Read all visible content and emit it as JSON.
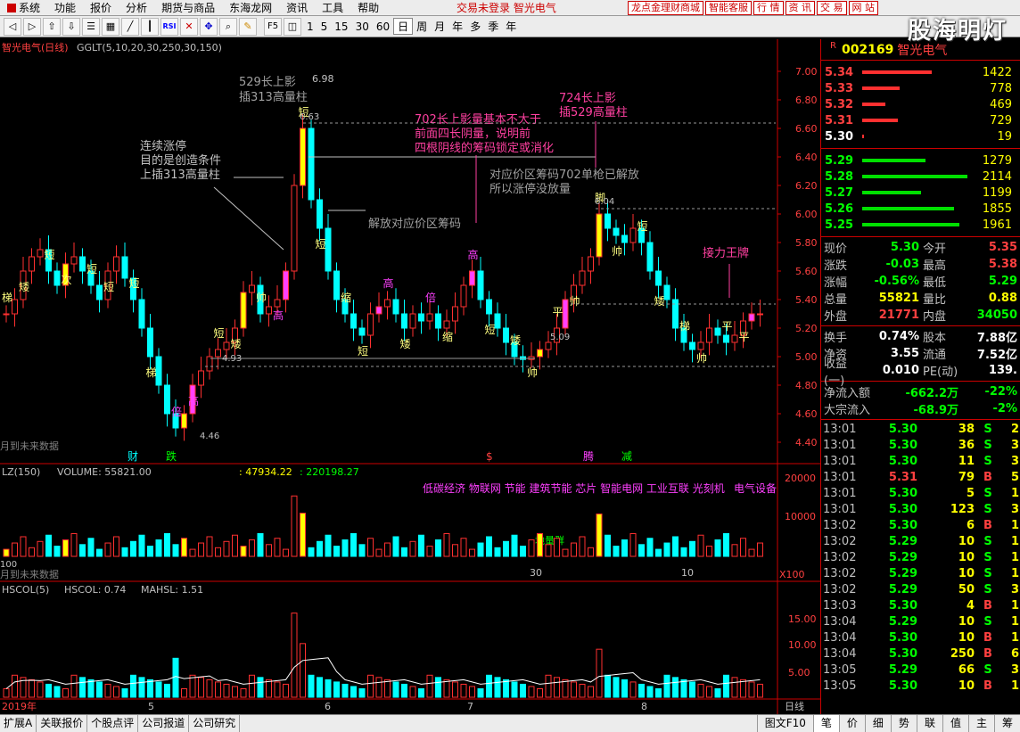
{
  "menu": {
    "items": [
      "系统",
      "功能",
      "报价",
      "分析",
      "期货与商品",
      "东海龙网",
      "资讯",
      "工具",
      "帮助"
    ],
    "center_text": "交易未登录 智光电气",
    "right_buttons": [
      "龙点金理财商城",
      "智能客服",
      "行 情",
      "资 讯",
      "交 易",
      "网 站"
    ]
  },
  "toolbar": {
    "icon_labels": [
      "RSI",
      "F5"
    ],
    "periods": [
      "1",
      "5",
      "15",
      "30",
      "60",
      "日",
      "周",
      "月",
      "年",
      "多",
      "季",
      "年"
    ]
  },
  "brandmark": "股海明灯",
  "main_chart": {
    "title": "智光电气(日线)",
    "indicator_label": "GGLT(5,10,20,30,250,30,150)",
    "future_data_label": "月到未来数据",
    "y_ticks": [
      "7.00",
      "6.80",
      "6.60",
      "6.40",
      "6.20",
      "6.00",
      "5.80",
      "5.60",
      "5.40",
      "5.20",
      "5.00",
      "4.80",
      "4.60",
      "4.40"
    ],
    "price_labels": [
      "6.98",
      "6.63",
      "6.04",
      "4.93",
      "5.09",
      "4.46"
    ],
    "annotations": {
      "a529": [
        "529长上影",
        "插313高量柱"
      ],
      "a724": [
        "724长上影",
        "插529高量柱"
      ],
      "a702": [
        "702长上影量基本不大于",
        "前面四长阴量，说明前",
        "四根阴线的筹码锁定或消化"
      ],
      "a_zt": [
        "连续涨停",
        "目的是创造条件",
        "上插313高量柱"
      ],
      "a_dy": [
        "对应价区筹码702单枪已解放",
        "所以涨停没放量"
      ],
      "a_jf": "解放对应价区筹码",
      "a_jl": "接力王牌"
    },
    "candle_marks": [
      "梯",
      "矮",
      "短",
      "次",
      "短",
      "短",
      "短",
      "梯",
      "倍",
      "高",
      "短",
      "矮",
      "帅",
      "高",
      "短",
      "短",
      "缩",
      "短",
      "高",
      "矮",
      "倍",
      "缩",
      "高",
      "短",
      "矮",
      "帅",
      "平",
      "帅",
      "脚",
      "帅",
      "短",
      "矮",
      "梯",
      "帅",
      "平",
      "平"
    ],
    "event_markers": [
      "财",
      "跌",
      "$",
      "腾",
      "减"
    ]
  },
  "volume_chart": {
    "label_lz": "LZ(150)",
    "label_volume": "VOLUME: 55821.00",
    "label_v2": ": 47934.22",
    "label_v3": ": 220198.27",
    "concepts": "低碳经济 物联网 节能 建筑节能 芯片 智能电网 工业互联 光刻机",
    "concept2": "电气设备",
    "y_ticks": [
      "20000",
      "10000"
    ],
    "x_label_30": "30",
    "x_label_10": "10",
    "unit": "X100",
    "future_label": "月到未来数据",
    "mark_dlj": "地量群",
    "left_num": "100"
  },
  "hscol_chart": {
    "label": "HSCOL(5)",
    "hscol_val": "HSCOL: 0.74",
    "mahsl_val": "MAHSL: 1.51",
    "y_ticks": [
      "15.00",
      "10.00",
      "5.00"
    ],
    "x_labels": [
      "2019年",
      "5",
      "6",
      "7",
      "8"
    ],
    "period_label": "日线"
  },
  "quote": {
    "code": "002169",
    "name": "智光电气",
    "asks": [
      {
        "price": "5.34",
        "vol": "1422",
        "pct": 0.66
      },
      {
        "price": "5.33",
        "vol": "778",
        "pct": 0.36
      },
      {
        "price": "5.32",
        "vol": "469",
        "pct": 0.22
      },
      {
        "price": "5.31",
        "vol": "729",
        "pct": 0.34
      },
      {
        "price": "5.30",
        "vol": "19",
        "pct": 0.02
      }
    ],
    "bids": [
      {
        "price": "5.29",
        "vol": "1279",
        "pct": 0.6
      },
      {
        "price": "5.28",
        "vol": "2114",
        "pct": 1.0
      },
      {
        "price": "5.27",
        "vol": "1199",
        "pct": 0.56
      },
      {
        "price": "5.26",
        "vol": "1855",
        "pct": 0.87
      },
      {
        "price": "5.25",
        "vol": "1961",
        "pct": 0.92
      }
    ],
    "stats": [
      {
        "l": "现价",
        "a": "5.30",
        "l2": "今开",
        "b": "5.35",
        "ac": "#00ff00",
        "bc": "#ff4040"
      },
      {
        "l": "涨跌",
        "a": "-0.03",
        "l2": "最高",
        "b": "5.38",
        "ac": "#00ff00",
        "bc": "#ff4040"
      },
      {
        "l": "涨幅",
        "a": "-0.56%",
        "l2": "最低",
        "b": "5.29",
        "ac": "#00ff00",
        "bc": "#00ff00"
      },
      {
        "l": "总量",
        "a": "55821",
        "l2": "量比",
        "b": "0.88",
        "ac": "#ffff00",
        "bc": "#ffff00"
      },
      {
        "l": "外盘",
        "a": "21771",
        "l2": "内盘",
        "b": "34050",
        "ac": "#ff4040",
        "bc": "#00ff00"
      }
    ],
    "stats2": [
      {
        "l": "换手",
        "a": "0.74%",
        "l2": "股本",
        "b": "7.88亿",
        "ac": "#ffffff",
        "bc": "#ffffff"
      },
      {
        "l": "净资",
        "a": "3.55",
        "l2": "流通",
        "b": "7.52亿",
        "ac": "#ffffff",
        "bc": "#ffffff"
      },
      {
        "l": "收益(一)",
        "a": "0.010",
        "l2": "PE(动)",
        "b": "139.",
        "ac": "#ffffff",
        "bc": "#ffffff"
      }
    ],
    "flows": [
      {
        "l": "净流入额",
        "a": "-662.2万",
        "b": "-22%"
      },
      {
        "l": "大宗流入",
        "a": "-68.9万",
        "b": "-2%"
      }
    ],
    "ticks": [
      {
        "t": "13:01",
        "p": "5.30",
        "v": "38",
        "s": "S",
        "x": "2"
      },
      {
        "t": "13:01",
        "p": "5.30",
        "v": "36",
        "s": "S",
        "x": "3"
      },
      {
        "t": "13:01",
        "p": "5.30",
        "v": "11",
        "s": "S",
        "x": "3"
      },
      {
        "t": "13:01",
        "p": "5.31",
        "v": "79",
        "s": "B",
        "x": "5"
      },
      {
        "t": "13:01",
        "p": "5.30",
        "v": "5",
        "s": "S",
        "x": "1"
      },
      {
        "t": "13:01",
        "p": "5.30",
        "v": "123",
        "s": "S",
        "x": "3"
      },
      {
        "t": "13:02",
        "p": "5.30",
        "v": "6",
        "s": "B",
        "x": "1"
      },
      {
        "t": "13:02",
        "p": "5.29",
        "v": "10",
        "s": "S",
        "x": "1"
      },
      {
        "t": "13:02",
        "p": "5.29",
        "v": "10",
        "s": "S",
        "x": "1"
      },
      {
        "t": "13:02",
        "p": "5.29",
        "v": "10",
        "s": "S",
        "x": "1"
      },
      {
        "t": "13:02",
        "p": "5.29",
        "v": "50",
        "s": "S",
        "x": "3"
      },
      {
        "t": "13:03",
        "p": "5.30",
        "v": "4",
        "s": "B",
        "x": "1"
      },
      {
        "t": "13:04",
        "p": "5.29",
        "v": "10",
        "s": "S",
        "x": "1"
      },
      {
        "t": "13:04",
        "p": "5.30",
        "v": "10",
        "s": "B",
        "x": "1"
      },
      {
        "t": "13:04",
        "p": "5.30",
        "v": "250",
        "s": "B",
        "x": "6"
      },
      {
        "t": "13:05",
        "p": "5.29",
        "v": "66",
        "s": "S",
        "x": "3"
      },
      {
        "t": "13:05",
        "p": "5.30",
        "v": "10",
        "s": "B",
        "x": "1"
      }
    ]
  },
  "bottom": {
    "tabs": [
      "扩展A",
      "关联报价",
      "个股点评",
      "公司报道",
      "公司研究"
    ],
    "right_tab": "图文F10",
    "right_items": [
      "笔",
      "价",
      "细",
      "势",
      "联",
      "值",
      "主",
      "筹"
    ]
  },
  "colors": {
    "up": "#ff3030",
    "down": "#00ffff",
    "bid_bar": "#00e000",
    "ask_bar": "#ff3030"
  }
}
